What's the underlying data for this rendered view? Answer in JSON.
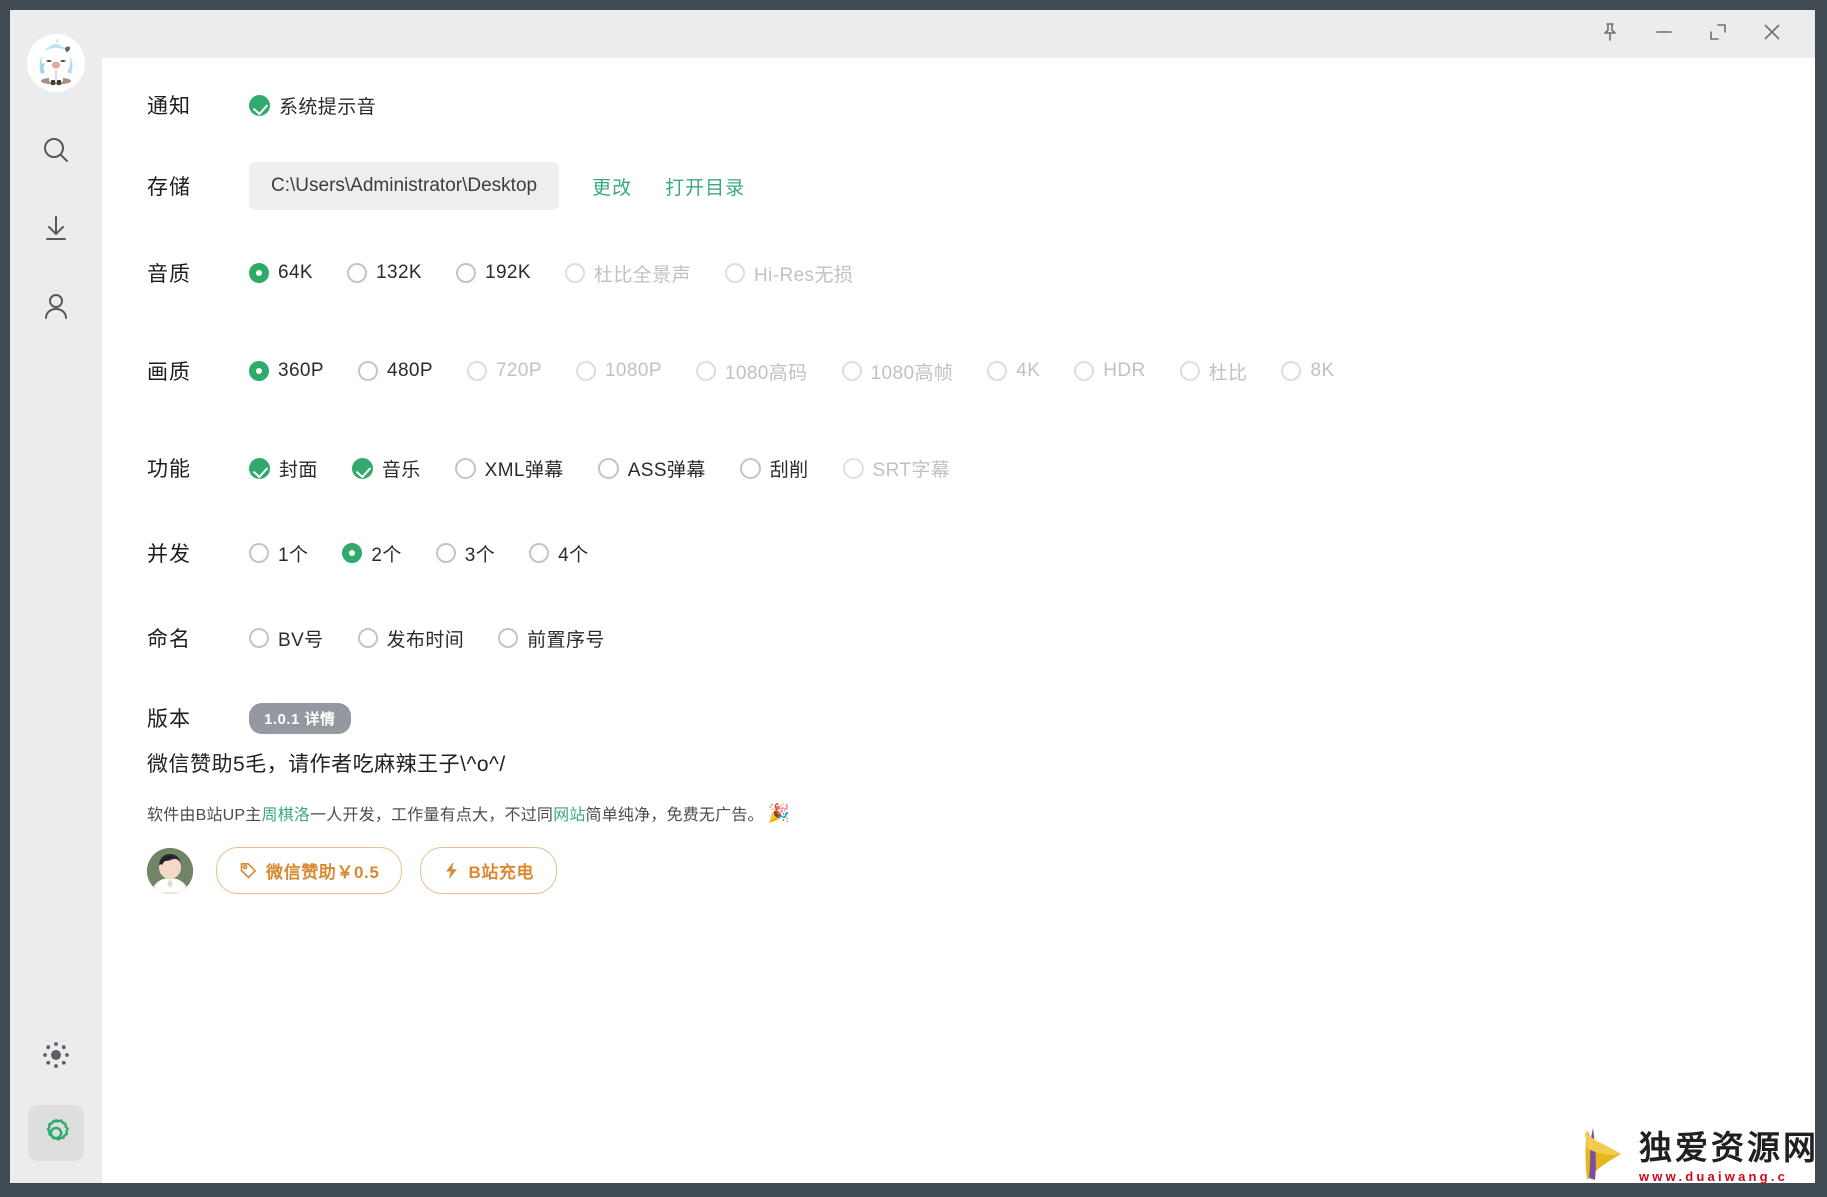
{
  "window": {
    "controls": [
      {
        "name": "pin",
        "label": "固定"
      },
      {
        "name": "minimize",
        "label": "最小化"
      },
      {
        "name": "maximize",
        "label": "最大化"
      },
      {
        "name": "close",
        "label": "关闭"
      }
    ]
  },
  "sidebar": {
    "items": [
      {
        "icon": "search-icon",
        "label": "搜索"
      },
      {
        "icon": "download-icon",
        "label": "下载"
      },
      {
        "icon": "user-icon",
        "label": "用户"
      }
    ],
    "bottom_items": [
      {
        "icon": "brightness-icon",
        "label": "主题",
        "active": false
      },
      {
        "icon": "gear-icon",
        "label": "设置",
        "active": true
      }
    ]
  },
  "settings": {
    "notification": {
      "label": "通知",
      "options": [
        {
          "text": "系统提示音",
          "state": "checked",
          "type": "check"
        }
      ]
    },
    "storage": {
      "label": "存储",
      "path": "C:\\Users\\Administrator\\Desktop",
      "change_label": "更改",
      "open_dir_label": "打开目录"
    },
    "audio_quality": {
      "label": "音质",
      "options": [
        {
          "text": "64K",
          "state": "checked",
          "type": "radio"
        },
        {
          "text": "132K",
          "state": "enabled",
          "type": "radio"
        },
        {
          "text": "192K",
          "state": "enabled",
          "type": "radio"
        },
        {
          "text": "杜比全景声",
          "state": "disabled",
          "type": "radio"
        },
        {
          "text": "Hi-Res无损",
          "state": "disabled",
          "type": "radio"
        }
      ]
    },
    "video_quality": {
      "label": "画质",
      "options": [
        {
          "text": "360P",
          "state": "checked",
          "type": "radio"
        },
        {
          "text": "480P",
          "state": "enabled",
          "type": "radio"
        },
        {
          "text": "720P",
          "state": "disabled",
          "type": "radio"
        },
        {
          "text": "1080P",
          "state": "disabled",
          "type": "radio"
        },
        {
          "text": "1080高码",
          "state": "disabled",
          "type": "radio"
        },
        {
          "text": "1080高帧",
          "state": "disabled",
          "type": "radio"
        },
        {
          "text": "4K",
          "state": "disabled",
          "type": "radio"
        },
        {
          "text": "HDR",
          "state": "disabled",
          "type": "radio"
        },
        {
          "text": "杜比",
          "state": "disabled",
          "type": "radio"
        },
        {
          "text": "8K",
          "state": "disabled",
          "type": "radio"
        }
      ]
    },
    "feature": {
      "label": "功能",
      "options": [
        {
          "text": "封面",
          "state": "checked",
          "type": "check"
        },
        {
          "text": "音乐",
          "state": "checked",
          "type": "check"
        },
        {
          "text": "XML弹幕",
          "state": "enabled",
          "type": "check"
        },
        {
          "text": "ASS弹幕",
          "state": "enabled",
          "type": "check"
        },
        {
          "text": "刮削",
          "state": "enabled",
          "type": "check"
        },
        {
          "text": "SRT字幕",
          "state": "disabled",
          "type": "check"
        }
      ]
    },
    "concurrency": {
      "label": "并发",
      "options": [
        {
          "text": "1个",
          "state": "enabled",
          "type": "radio"
        },
        {
          "text": "2个",
          "state": "checked",
          "type": "radio"
        },
        {
          "text": "3个",
          "state": "enabled",
          "type": "radio"
        },
        {
          "text": "4个",
          "state": "enabled",
          "type": "radio"
        }
      ]
    },
    "naming": {
      "label": "命名",
      "options": [
        {
          "text": "BV号",
          "state": "enabled",
          "type": "radio"
        },
        {
          "text": "发布时间",
          "state": "enabled",
          "type": "radio"
        },
        {
          "text": "前置序号",
          "state": "enabled",
          "type": "radio"
        }
      ]
    },
    "version": {
      "label": "版本",
      "badge": "1.0.1 详情"
    }
  },
  "sponsor": {
    "title": "微信赞助5毛，请作者吃麻辣王子\\^o^/",
    "desc_part1": "软件由B站UP主 ",
    "desc_author": "周棋洛",
    "desc_part2": " 一人开发，工作量有点大，不过同 ",
    "desc_site": "网站",
    "desc_part3": " 简单纯净，免费无广告。",
    "desc_emoji": "🎉",
    "wechat_button": "微信赞助￥0.5",
    "bilibili_button": "B站充电"
  },
  "watermark": {
    "name": "独爱资源网",
    "url": "www.duaiwang.c"
  },
  "colors": {
    "accent_green": "#2eaa69",
    "link_green": "#3aa981",
    "orange": "#d98a31",
    "frame": "#3f4a52",
    "sidebar": "#ececec",
    "badge_gray": "#9499a1"
  }
}
